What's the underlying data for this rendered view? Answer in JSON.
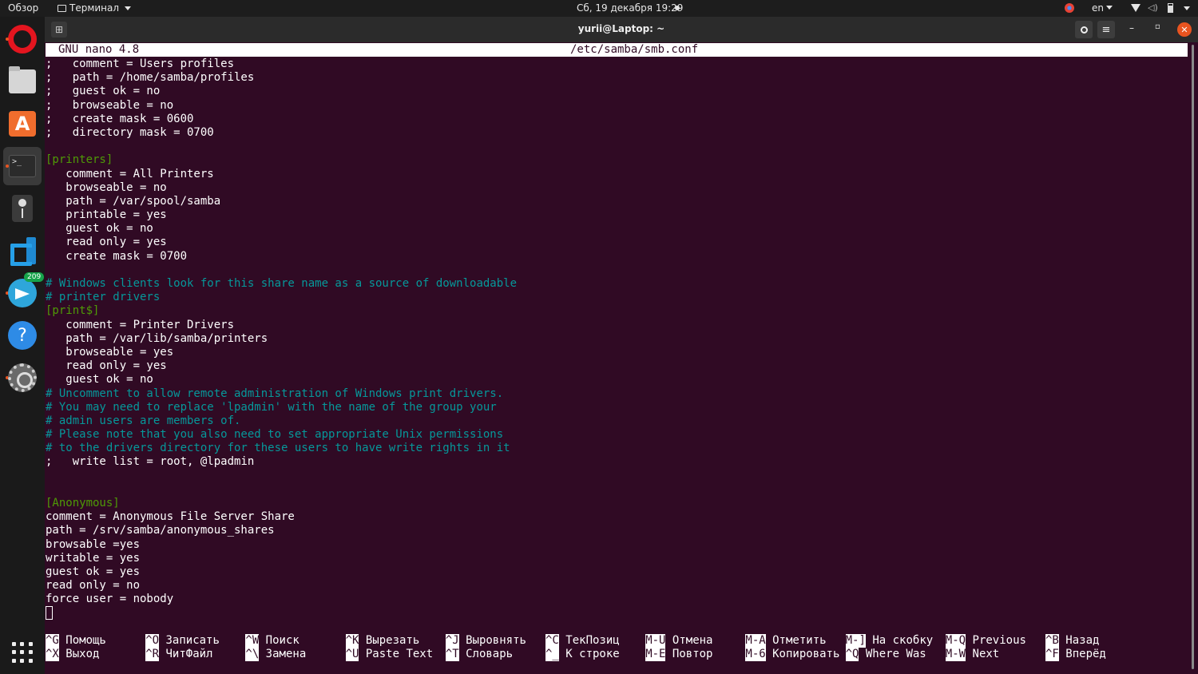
{
  "topbar": {
    "overview": "Обзор",
    "app_menu": "Терминал",
    "clock": "Сб, 19 декабря  19:29",
    "language": "en"
  },
  "dock": {
    "items": [
      "opera-browser",
      "files",
      "ubuntu-software",
      "terminal",
      "webcam",
      "vscode",
      "telegram",
      "help",
      "settings"
    ],
    "telegram_badge": "209"
  },
  "window": {
    "title": "yurii@Laptop: ~",
    "min_label": "–",
    "max_label": "▫",
    "close_label": "✕",
    "newtab_label": "⊞",
    "menu_label": "≡"
  },
  "nano": {
    "version": "GNU nano 4.8",
    "filename": "/etc/samba/smb.conf",
    "colors": {
      "bg": "#300a24",
      "text": "#ffffff",
      "section": "#4e9a06",
      "comment": "#06989a"
    },
    "lines": [
      {
        "t": ";   comment = Users profiles",
        "k": "text"
      },
      {
        "t": ";   path = /home/samba/profiles",
        "k": "text"
      },
      {
        "t": ";   guest ok = no",
        "k": "text"
      },
      {
        "t": ";   browseable = no",
        "k": "text"
      },
      {
        "t": ";   create mask = 0600",
        "k": "text"
      },
      {
        "t": ";   directory mask = 0700",
        "k": "text"
      },
      {
        "t": "",
        "k": "text"
      },
      {
        "t": "[printers]",
        "k": "section"
      },
      {
        "t": "   comment = All Printers",
        "k": "text"
      },
      {
        "t": "   browseable = no",
        "k": "text"
      },
      {
        "t": "   path = /var/spool/samba",
        "k": "text"
      },
      {
        "t": "   printable = yes",
        "k": "text"
      },
      {
        "t": "   guest ok = no",
        "k": "text"
      },
      {
        "t": "   read only = yes",
        "k": "text"
      },
      {
        "t": "   create mask = 0700",
        "k": "text"
      },
      {
        "t": "",
        "k": "text"
      },
      {
        "t": "# Windows clients look for this share name as a source of downloadable",
        "k": "comment"
      },
      {
        "t": "# printer drivers",
        "k": "comment"
      },
      {
        "t": "[print$]",
        "k": "section"
      },
      {
        "t": "   comment = Printer Drivers",
        "k": "text"
      },
      {
        "t": "   path = /var/lib/samba/printers",
        "k": "text"
      },
      {
        "t": "   browseable = yes",
        "k": "text"
      },
      {
        "t": "   read only = yes",
        "k": "text"
      },
      {
        "t": "   guest ok = no",
        "k": "text"
      },
      {
        "t": "# Uncomment to allow remote administration of Windows print drivers.",
        "k": "comment"
      },
      {
        "t": "# You may need to replace 'lpadmin' with the name of the group your",
        "k": "comment"
      },
      {
        "t": "# admin users are members of.",
        "k": "comment"
      },
      {
        "t": "# Please note that you also need to set appropriate Unix permissions",
        "k": "comment"
      },
      {
        "t": "# to the drivers directory for these users to have write rights in it",
        "k": "comment"
      },
      {
        "t": ";   write list = root, @lpadmin",
        "k": "text"
      },
      {
        "t": "",
        "k": "text"
      },
      {
        "t": "",
        "k": "text"
      },
      {
        "t": "[Anonymous]",
        "k": "section"
      },
      {
        "t": "comment = Anonymous File Server Share",
        "k": "text"
      },
      {
        "t": "path = /srv/samba/anonymous_shares",
        "k": "text"
      },
      {
        "t": "browsable =yes",
        "k": "text"
      },
      {
        "t": "writable = yes",
        "k": "text"
      },
      {
        "t": "guest ok = yes",
        "k": "text"
      },
      {
        "t": "read only = no",
        "k": "text"
      },
      {
        "t": "force user = nobody",
        "k": "text"
      }
    ],
    "shortcuts": [
      {
        "key": "^G",
        "label": "Помощь"
      },
      {
        "key": "^X",
        "label": "Выход"
      },
      {
        "key": "^O",
        "label": "Записать"
      },
      {
        "key": "^R",
        "label": "ЧитФайл"
      },
      {
        "key": "^W",
        "label": "Поиск"
      },
      {
        "key": "^\\",
        "label": "Замена"
      },
      {
        "key": "^K",
        "label": "Вырезать"
      },
      {
        "key": "^U",
        "label": "Paste Text"
      },
      {
        "key": "^J",
        "label": "Выровнять"
      },
      {
        "key": "^T",
        "label": "Словарь"
      },
      {
        "key": "^C",
        "label": "ТекПозиц"
      },
      {
        "key": "^_",
        "label": "К строке"
      },
      {
        "key": "M-U",
        "label": "Отмена"
      },
      {
        "key": "M-E",
        "label": "Повтор"
      },
      {
        "key": "M-A",
        "label": "Отметить"
      },
      {
        "key": "M-6",
        "label": "Копировать"
      },
      {
        "key": "M-]",
        "label": "На скобку"
      },
      {
        "key": "^Q",
        "label": "Where Was"
      },
      {
        "key": "M-Q",
        "label": "Previous"
      },
      {
        "key": "M-W",
        "label": "Next"
      },
      {
        "key": "^B",
        "label": "Назад"
      },
      {
        "key": "^F",
        "label": "Вперёд"
      }
    ]
  }
}
